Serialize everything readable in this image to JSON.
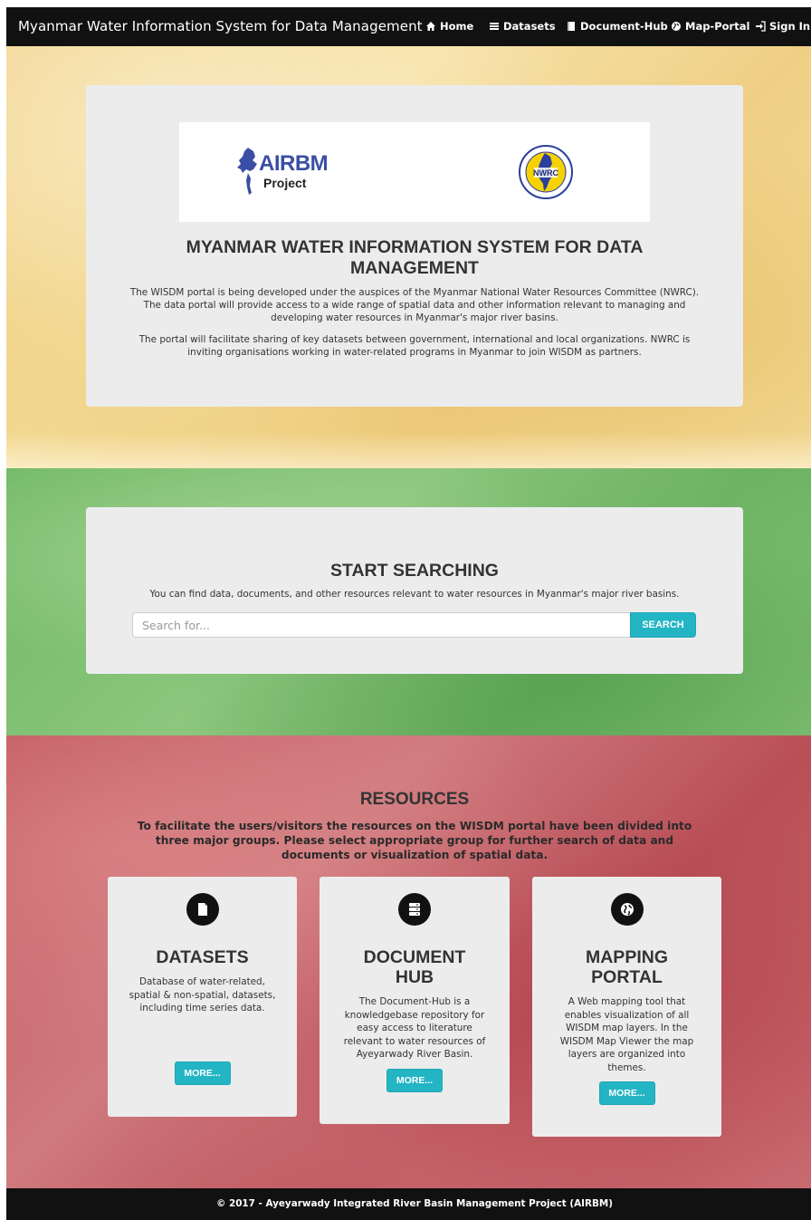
{
  "navbar": {
    "brand": "Myanmar Water Information System for Data Management",
    "items": [
      {
        "label": "Home",
        "icon": "home-icon"
      },
      {
        "label": "Datasets",
        "icon": "list-icon"
      },
      {
        "label": "Document-Hub",
        "icon": "document-icon"
      },
      {
        "label": "Map-Portal",
        "icon": "globe-icon"
      },
      {
        "label": "Sign In",
        "icon": "sign-in-icon"
      }
    ]
  },
  "intro": {
    "airbm_logo_text": "AIRBM",
    "airbm_logo_sub": "Project",
    "title": "MYANMAR WATER INFORMATION SYSTEM FOR DATA MANAGEMENT",
    "paragraph1": "The WISDM portal is being developed under the auspices of the Myanmar National Water Resources Committee (NWRC). The data portal will provide access to a wide range of spatial data and other information relevant to managing and developing water resources in Myanmar's major river basins.",
    "paragraph2": "The portal will facilitate sharing of key datasets between government, international and local organizations. NWRC is inviting organisations working in water-related programs in Myanmar to join WISDM as partners."
  },
  "search": {
    "title": "START SEARCHING",
    "subtitle": "You can find data, documents, and other resources relevant to water resources in Myanmar's major river basins.",
    "placeholder": "Search for...",
    "value": "",
    "button_label": "SEARCH"
  },
  "resources": {
    "title": "RESOURCES",
    "subtitle": "To facilitate the users/visitors the resources on the WISDM portal have been divided into three major groups. Please select appropriate group for further search of data and documents or visualization of spatial data.",
    "cards": [
      {
        "title": "DATASETS",
        "icon": "file-icon",
        "description": "Database of water-related, spatial & non-spatial, datasets, including time series data.",
        "button_label": "MORE..."
      },
      {
        "title": "DOCUMENT HUB",
        "icon": "server-icon",
        "description": "The Document-Hub is a knowledgebase repository for easy access to literature relevant to water resources of Ayeyarwady River Basin.",
        "button_label": "MORE..."
      },
      {
        "title": "MAPPING PORTAL",
        "icon": "globe-icon",
        "description": "A Web mapping tool that enables visualization of all WISDM map layers. In the WISDM Map Viewer the map layers are organized into themes.",
        "button_label": "MORE..."
      }
    ]
  },
  "footer": {
    "text": "© 2017 - Ayeyarwady Integrated River Basin Management Project (AIRBM)"
  },
  "colors": {
    "navbar": "#111111",
    "accent_button": "#23b5c4",
    "panel": "#ececed",
    "band_yellow": "#f2d58c",
    "band_green": "#6fb865",
    "band_red": "#c0575e"
  }
}
